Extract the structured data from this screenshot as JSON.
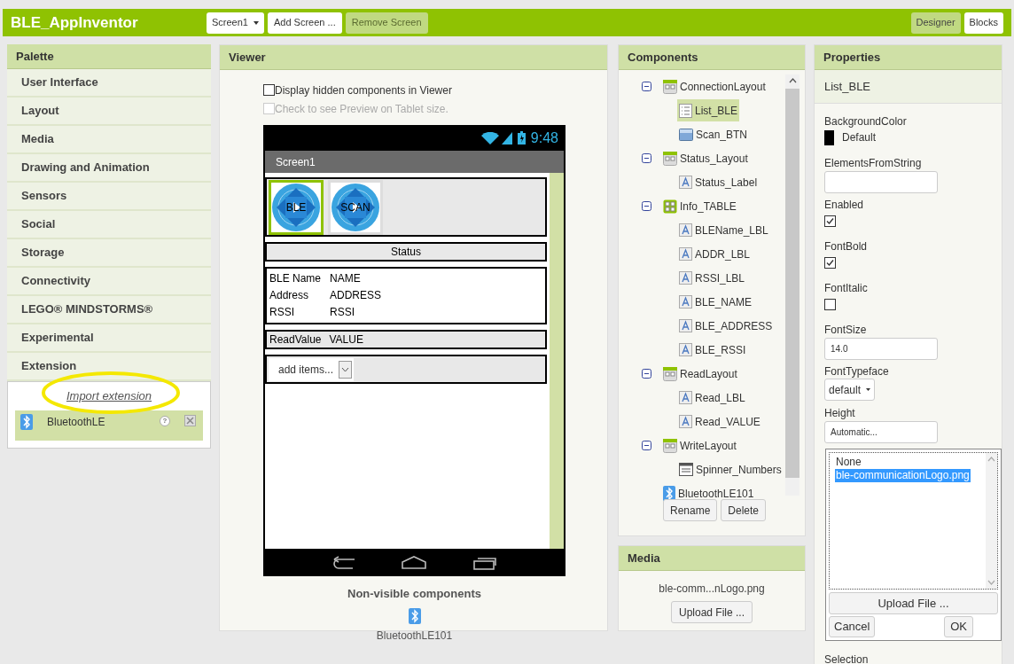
{
  "app": {
    "title": "BLE_AppInventor",
    "screen_selector": "Screen1",
    "buttons": [
      {
        "label": "Add Screen ...",
        "disabled": false
      },
      {
        "label": "Remove Screen",
        "disabled": true
      }
    ],
    "mode_buttons": [
      {
        "label": "Designer",
        "selected": true
      },
      {
        "label": "Blocks",
        "selected": false
      }
    ]
  },
  "palette": {
    "title": "Palette",
    "categories": [
      "User Interface",
      "Layout",
      "Media",
      "Drawing and Animation",
      "Sensors",
      "Social",
      "Storage",
      "Connectivity",
      "LEGO® MINDSTORMS®",
      "Experimental",
      "Extension"
    ],
    "import_link": "Import extension",
    "extensions": [
      {
        "name": "BluetoothLE",
        "help": "?"
      }
    ]
  },
  "viewer": {
    "title": "Viewer",
    "checkboxes": [
      {
        "label": "Display hidden components in Viewer",
        "checked": false,
        "disabled": false
      },
      {
        "label": "Check to see Preview on Tablet size.",
        "checked": false,
        "disabled": true
      }
    ],
    "phone": {
      "time": "9:48",
      "screen_title": "Screen1",
      "image_buttons": [
        {
          "label": "BLE",
          "selected": true
        },
        {
          "label": "SCAN",
          "selected": false
        }
      ],
      "status_text": "Status",
      "info_rows": [
        {
          "label": "BLE Name",
          "value": "NAME"
        },
        {
          "label": "Address",
          "value": "ADDRESS"
        },
        {
          "label": "RSSI",
          "value": "RSSI"
        }
      ],
      "read_row": {
        "label": "ReadValue",
        "value": "VALUE"
      },
      "spinner": {
        "value": "add items..."
      }
    },
    "nonvisible": {
      "title": "Non-visible components",
      "items": [
        "BluetoothLE101"
      ]
    }
  },
  "components": {
    "title": "Components",
    "tree": [
      {
        "name": "ConnectionLayout",
        "kind": "arrangement",
        "selected": false,
        "expanded": true,
        "children": [
          {
            "name": "List_BLE",
            "kind": "listpicker",
            "selected": true
          },
          {
            "name": "Scan_BTN",
            "kind": "button",
            "selected": false
          }
        ]
      },
      {
        "name": "Status_Layout",
        "kind": "arrangement",
        "selected": false,
        "expanded": true,
        "children": [
          {
            "name": "Status_Label",
            "kind": "label",
            "selected": false
          }
        ]
      },
      {
        "name": "Info_TABLE",
        "kind": "table",
        "selected": false,
        "expanded": true,
        "children": [
          {
            "name": "BLEName_LBL",
            "kind": "label",
            "selected": false
          },
          {
            "name": "ADDR_LBL",
            "kind": "label",
            "selected": false
          },
          {
            "name": "RSSI_LBL",
            "kind": "label",
            "selected": false
          },
          {
            "name": "BLE_NAME",
            "kind": "label",
            "selected": false
          },
          {
            "name": "BLE_ADDRESS",
            "kind": "label",
            "selected": false
          },
          {
            "name": "BLE_RSSI",
            "kind": "label",
            "selected": false
          }
        ]
      },
      {
        "name": "ReadLayout",
        "kind": "arrangement",
        "selected": false,
        "expanded": true,
        "children": [
          {
            "name": "Read_LBL",
            "kind": "label",
            "selected": false
          },
          {
            "name": "Read_VALUE",
            "kind": "label",
            "selected": false
          }
        ]
      },
      {
        "name": "WriteLayout",
        "kind": "arrangement",
        "selected": false,
        "expanded": true,
        "children": [
          {
            "name": "Spinner_Numbers",
            "kind": "spinner",
            "selected": false
          }
        ]
      },
      {
        "name": "BluetoothLE101",
        "kind": "bluetooth",
        "selected": false
      }
    ],
    "buttons": [
      "Rename",
      "Delete"
    ]
  },
  "media": {
    "title": "Media",
    "files": [
      "ble-comm...nLogo.png"
    ],
    "upload": "Upload File ..."
  },
  "properties": {
    "title": "Properties",
    "component": "List_BLE",
    "props": [
      {
        "label": "BackgroundColor",
        "kind": "color",
        "value": "Default",
        "color": "#000000"
      },
      {
        "label": "ElementsFromString",
        "kind": "text"
      },
      {
        "label": "Enabled",
        "kind": "checkbox",
        "checked": true
      },
      {
        "label": "FontBold",
        "kind": "checkbox",
        "checked": true
      },
      {
        "label": "FontItalic",
        "kind": "checkbox",
        "checked": false
      },
      {
        "label": "FontSize",
        "kind": "text",
        "value": "14.0"
      },
      {
        "label": "FontTypeface",
        "kind": "dropdown",
        "value": "default"
      },
      {
        "label": "Height",
        "kind": "text",
        "value": "Automatic..."
      }
    ],
    "asset_picker": {
      "options": [
        {
          "label": "None",
          "selected": false
        },
        {
          "label": "ble-communicationLogo.png",
          "selected": true
        }
      ],
      "upload": "Upload File ...",
      "cancel": "Cancel",
      "ok": "OK"
    },
    "trailing_label": "Selection"
  }
}
